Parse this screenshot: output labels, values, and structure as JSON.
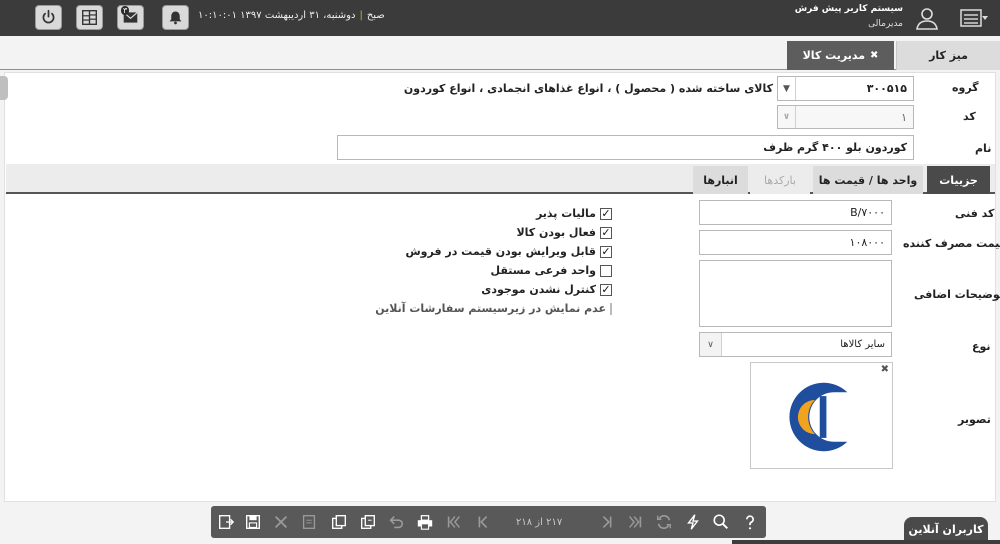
{
  "header": {
    "system_name": "سیستم کاربر پیش فرش",
    "user_role": "مدیرمالی",
    "date": "دوشنبه، ۳۱ اردیبهشت ۱۳۹۷",
    "separator": "|",
    "time": "۱۰:۱۰:۰۱ صبح",
    "mail_badge": "۳"
  },
  "tabs": {
    "desk": "میز کار",
    "goods": "مدیریت کالا",
    "goods_close": "✖"
  },
  "form": {
    "group_label": "گروه",
    "group_code": "۳۰۰۵۱۵",
    "group_path": "کالای ساخته شده ( محصول ) ، انواع غذاهای انجمادی ، انواع کوردون",
    "code_label": "کد",
    "code_value": "۱",
    "name_label": "نام",
    "name_value": "کوردون بلو ۴۰۰ گرم ظرف"
  },
  "inner_tabs": {
    "details": "جزییات",
    "units_prices": "واحد ها / قیمت ها",
    "barcodes": "بارکدها",
    "warehouses": "انبارها"
  },
  "details": {
    "tech_code_label": "کد فنی",
    "tech_code_value": "B/۷۰۰۰",
    "consumer_price_label": "قیمت مصرف کننده",
    "consumer_price_value": "۱۰۸۰۰۰",
    "extra_desc_label": "توضیحات اضافی",
    "type_label": "نوع",
    "type_value": "سایر کالاها",
    "image_label": "تصویر",
    "image_close": "✖"
  },
  "checkboxes": [
    {
      "label": "مالیات پذیر",
      "checked": true,
      "disabled": false
    },
    {
      "label": "فعال بودن کالا",
      "checked": true,
      "disabled": false
    },
    {
      "label": "قابل ویرایش بودن قیمت در فروش",
      "checked": true,
      "disabled": false
    },
    {
      "label": "واحد فرعی مستقل",
      "checked": false,
      "disabled": false
    },
    {
      "label": "کنترل نشدن موجودی",
      "checked": true,
      "disabled": false
    },
    {
      "label": "عدم نمایش در زیرسیستم سفارشات آنلاین",
      "checked": false,
      "disabled": true
    }
  ],
  "toolbar": {
    "pager_text": "۲۱۷ از ۲۱۸"
  },
  "footer": {
    "online_users": "کاربران آنلاین"
  },
  "colors": {
    "topbar": "#3b3b3b",
    "active_tab": "#5d5d5d",
    "logo_blue": "#1f4e9e",
    "logo_orange": "#f0a31c"
  }
}
